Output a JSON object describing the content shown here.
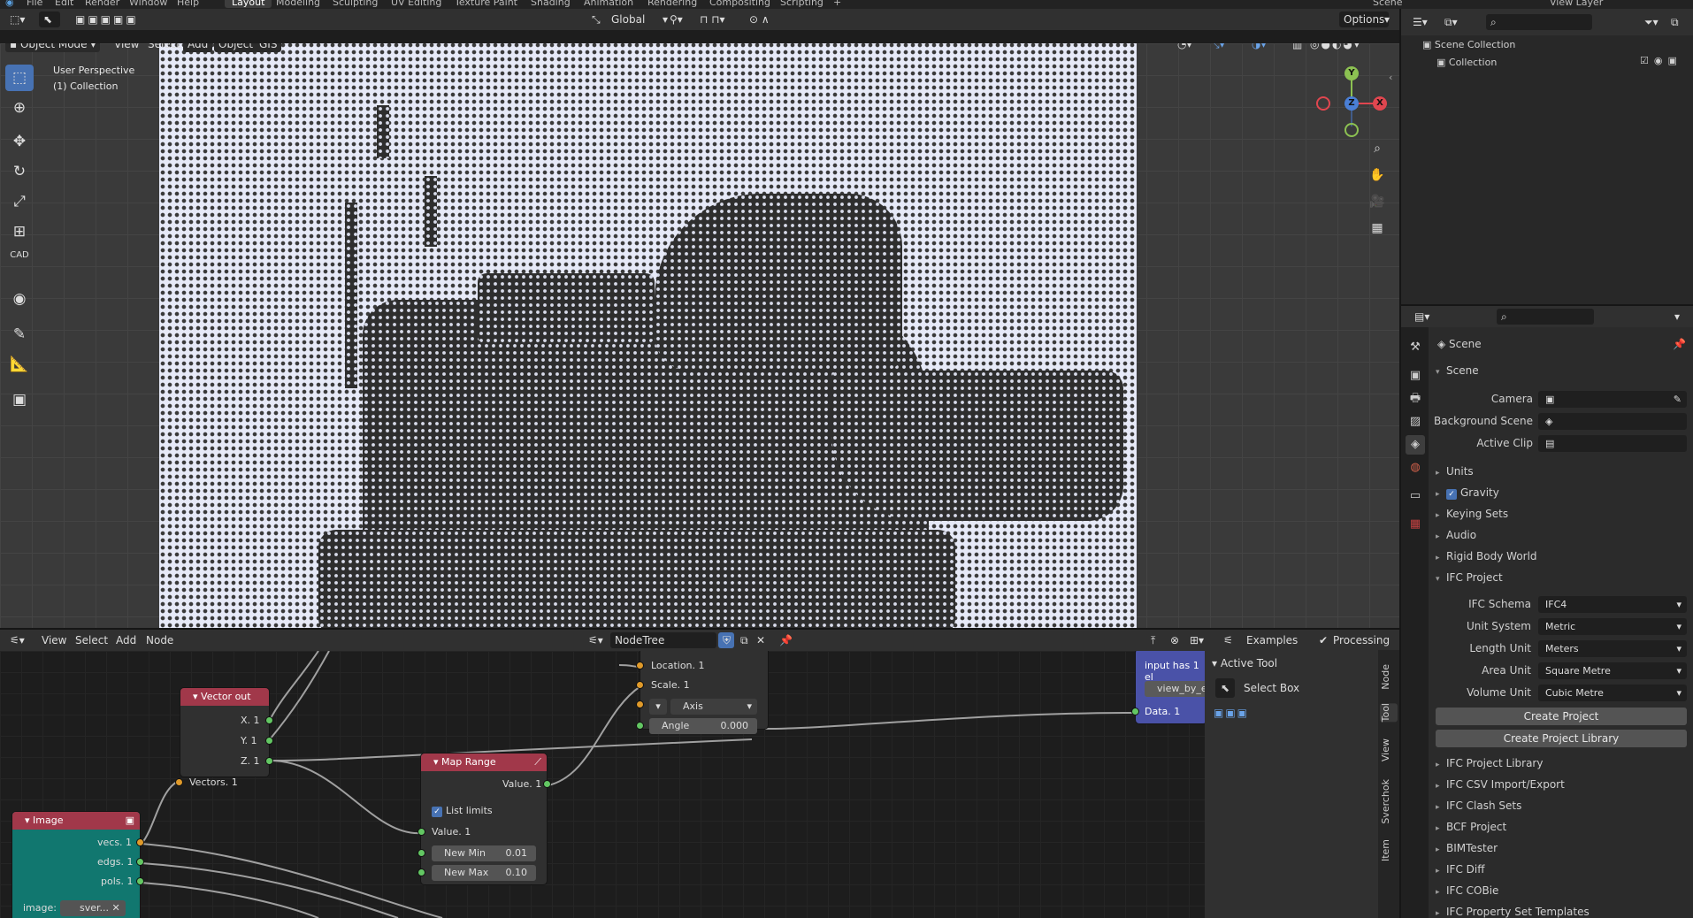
{
  "menu": {
    "file": "File",
    "edit": "Edit",
    "render": "Render",
    "window": "Window",
    "help": "Help"
  },
  "workspaces": [
    "Layout",
    "Modeling",
    "Sculpting",
    "UV Editing",
    "Texture Paint",
    "Shading",
    "Animation",
    "Rendering",
    "Compositing",
    "Scripting"
  ],
  "scene_name": "Scene",
  "view_layer": "View Layer",
  "viewport": {
    "transform_orientation": "Global",
    "options_label": "Options",
    "mode": "Object Mode",
    "menus": [
      "View",
      "Select",
      "Add",
      "Object",
      "GIS"
    ],
    "overlay_line1": "User Perspective",
    "overlay_line2": "(1) Collection",
    "gizmo": {
      "y": "Y",
      "z": "Z",
      "x": "X"
    },
    "tools": [
      "select-box",
      "cursor",
      "move",
      "rotate",
      "scale",
      "transform",
      "CAD",
      "select-circle",
      "annotate",
      "measure",
      "add-cube"
    ]
  },
  "outliner": {
    "scene_collection": "Scene Collection",
    "collection": "Collection"
  },
  "properties": {
    "header": "Scene",
    "section_scene": "Scene",
    "camera_label": "Camera",
    "bg_scene_label": "Background Scene",
    "active_clip_label": "Active Clip",
    "units": "Units",
    "gravity": "Gravity",
    "keying_sets": "Keying Sets",
    "audio": "Audio",
    "rigid_body_world": "Rigid Body World",
    "ifc_project": "IFC Project",
    "ifc_schema_label": "IFC Schema",
    "ifc_schema_value": "IFC4",
    "unit_system_label": "Unit System",
    "unit_system_value": "Metric",
    "length_unit_label": "Length Unit",
    "length_unit_value": "Meters",
    "area_unit_label": "Area Unit",
    "area_unit_value": "Square Metre",
    "volume_unit_label": "Volume Unit",
    "volume_unit_value": "Cubic Metre",
    "create_project": "Create Project",
    "create_project_library": "Create Project Library",
    "sections": [
      "IFC Project Library",
      "IFC CSV Import/Export",
      "IFC Clash Sets",
      "BCF Project",
      "BIMTester",
      "IFC Diff",
      "IFC COBie",
      "IFC Property Set Templates"
    ]
  },
  "node_editor": {
    "menus": [
      "View",
      "Select",
      "Add",
      "Node"
    ],
    "tree_name": "NodeTree",
    "examples": "Examples",
    "processing": "Processing",
    "tabs": [
      "Node",
      "Tool",
      "View",
      "Sverchok",
      "Item"
    ],
    "active_tool_title": "Active Tool",
    "active_tool_name": "Select Box",
    "vector_out": {
      "title": "Vector out",
      "x": "X. 1",
      "y": "Y. 1",
      "z": "Z. 1",
      "vectors": "Vectors. 1"
    },
    "image": {
      "title": "Image",
      "vecs": "vecs. 1",
      "edgs": "edgs. 1",
      "pols": "pols. 1",
      "image_label": "image:",
      "image_value": "sver..."
    },
    "map_range": {
      "title": "Map Range",
      "value_out": "Value. 1",
      "list_limits": "List limits",
      "value_in": "Value. 1",
      "new_min_label": "New Min",
      "new_min_value": "0.01",
      "new_max_label": "New Max",
      "new_max_value": "0.10"
    },
    "matrix": {
      "location": "Location. 1",
      "scale": "Scale. 1",
      "axis": "Axis",
      "angle_label": "Angle",
      "angle_value": "0.000"
    },
    "viewer": {
      "title": "input has 1 el",
      "button": "view_by_e",
      "data": "Data. 1"
    }
  }
}
